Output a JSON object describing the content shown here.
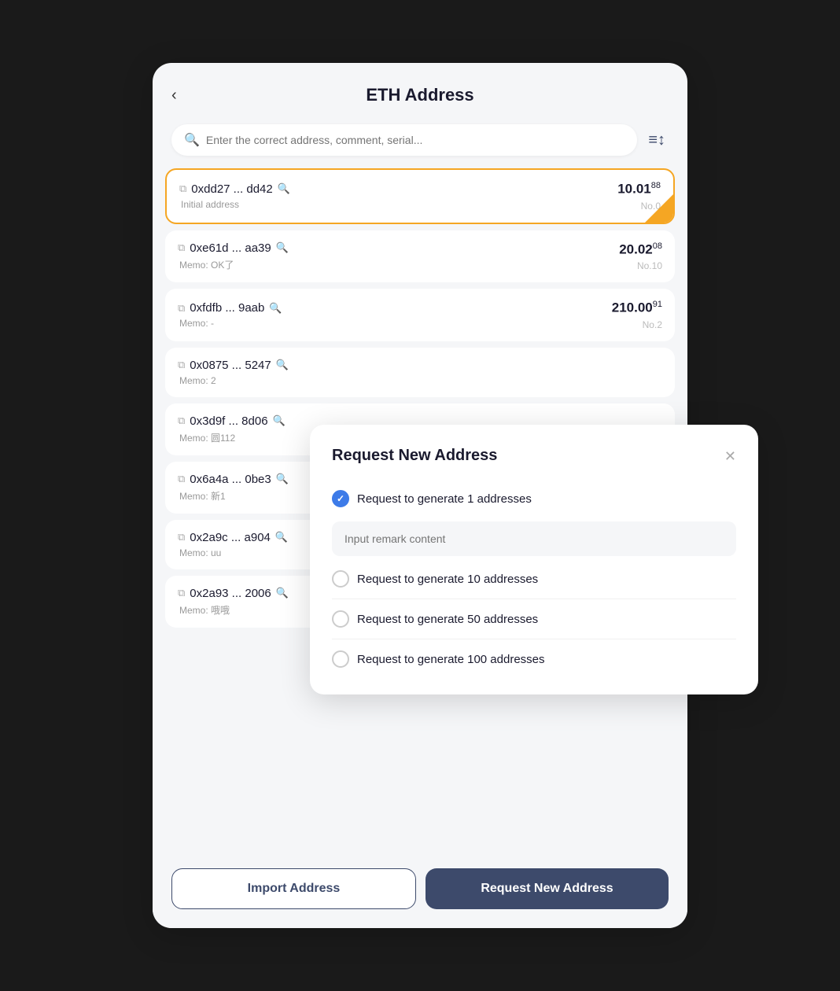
{
  "header": {
    "title": "ETH Address",
    "back_label": "‹"
  },
  "search": {
    "placeholder": "Enter the correct address, comment, serial..."
  },
  "filter_icon": "≡↕",
  "addresses": [
    {
      "address": "0xdd27 ... dd42",
      "memo": "Initial address",
      "balance_main": "10.01",
      "balance_sup": "88",
      "no_label": "No.0",
      "active": true
    },
    {
      "address": "0xe61d ... aa39",
      "memo": "Memo: OK了",
      "balance_main": "20.02",
      "balance_sup": "08",
      "no_label": "No.10",
      "active": false
    },
    {
      "address": "0xfdfb ... 9aab",
      "memo": "Memo: -",
      "balance_main": "210.00",
      "balance_sup": "91",
      "no_label": "No.2",
      "active": false
    },
    {
      "address": "0x0875 ... 5247",
      "memo": "Memo: 2",
      "balance_main": "",
      "balance_sup": "",
      "no_label": "",
      "active": false
    },
    {
      "address": "0x3d9f ... 8d06",
      "memo": "Memo: 圆112",
      "balance_main": "",
      "balance_sup": "",
      "no_label": "",
      "active": false
    },
    {
      "address": "0x6a4a ... 0be3",
      "memo": "Memo: 新1",
      "balance_main": "",
      "balance_sup": "",
      "no_label": "",
      "active": false
    },
    {
      "address": "0x2a9c ... a904",
      "memo": "Memo: uu",
      "balance_main": "",
      "balance_sup": "",
      "no_label": "",
      "active": false
    },
    {
      "address": "0x2a93 ... 2006",
      "memo": "Memo: 哦哦",
      "balance_main": "",
      "balance_sup": "",
      "no_label": "",
      "active": false
    }
  ],
  "buttons": {
    "import_label": "Import Address",
    "request_label": "Request New Address"
  },
  "modal": {
    "title": "Request New Address",
    "close_label": "✕",
    "options": [
      {
        "label": "Request to generate 1 addresses",
        "checked": true
      },
      {
        "label": "Request to generate 10 addresses",
        "checked": false
      },
      {
        "label": "Request to generate 50 addresses",
        "checked": false
      },
      {
        "label": "Request to generate 100 addresses",
        "checked": false
      }
    ],
    "remark_placeholder": "Input remark content"
  }
}
